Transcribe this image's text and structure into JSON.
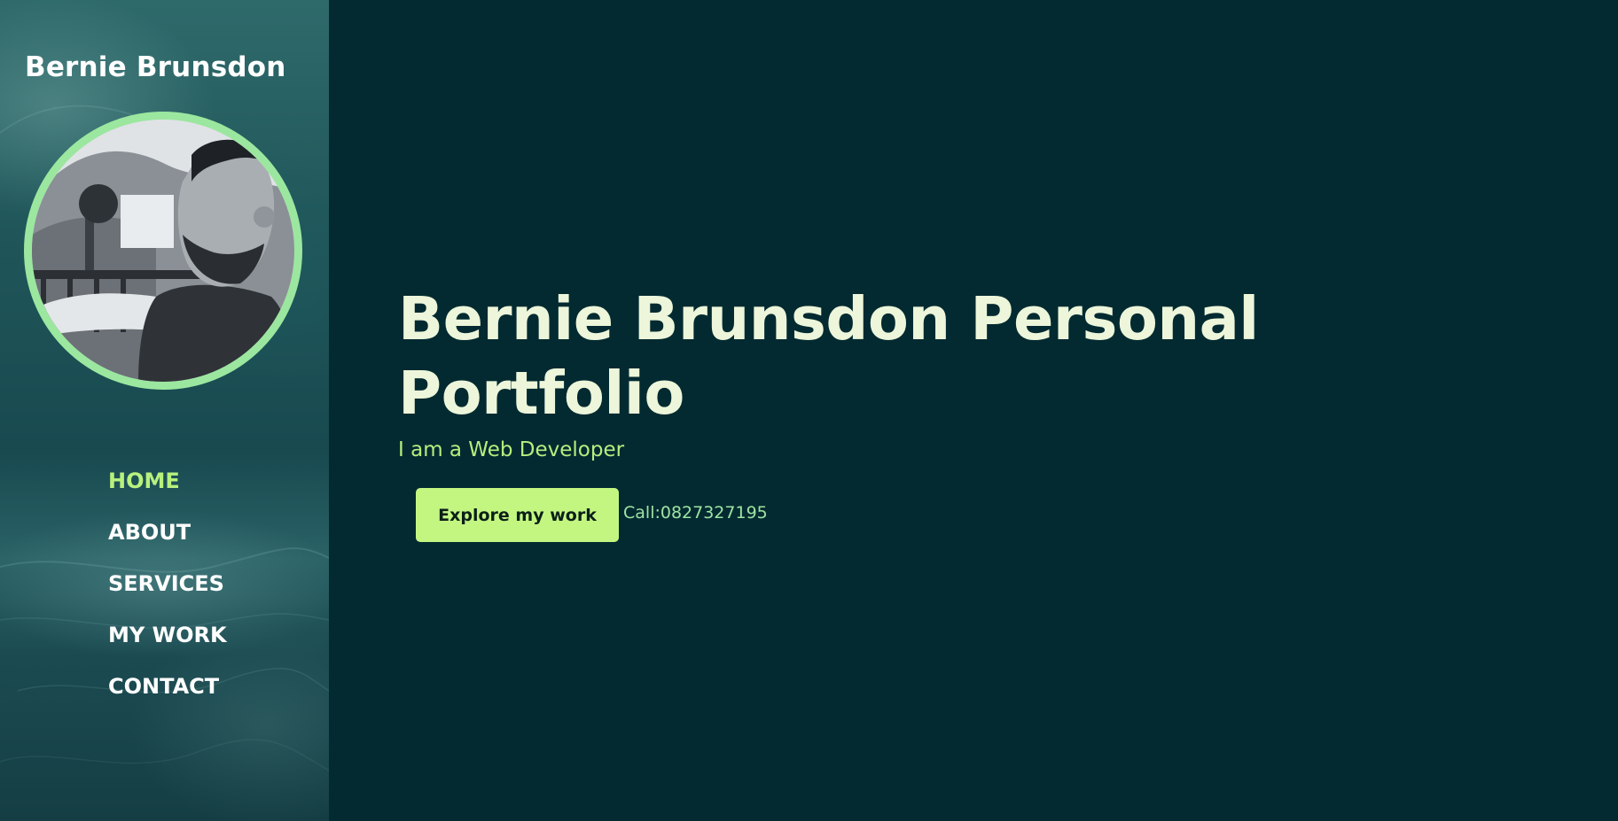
{
  "sidebar": {
    "site_title": "Bernie Brunsdon",
    "avatar_icon": "profile-photo",
    "nav": [
      {
        "label": "HOME",
        "active": true
      },
      {
        "label": "ABOUT",
        "active": false
      },
      {
        "label": "SERVICES",
        "active": false
      },
      {
        "label": "MY WORK",
        "active": false
      },
      {
        "label": "CONTACT",
        "active": false
      }
    ]
  },
  "hero": {
    "title": "Bernie Brunsdon Personal Portfolio",
    "subtitle": "I am a Web Developer",
    "cta_label": "Explore my work",
    "phone": "Call:0827327195"
  },
  "colors": {
    "background": "#032a31",
    "accent": "#c3f681",
    "nav_active": "#b8f17d",
    "avatar_ring": "#9be79f",
    "title": "#edf6da"
  }
}
